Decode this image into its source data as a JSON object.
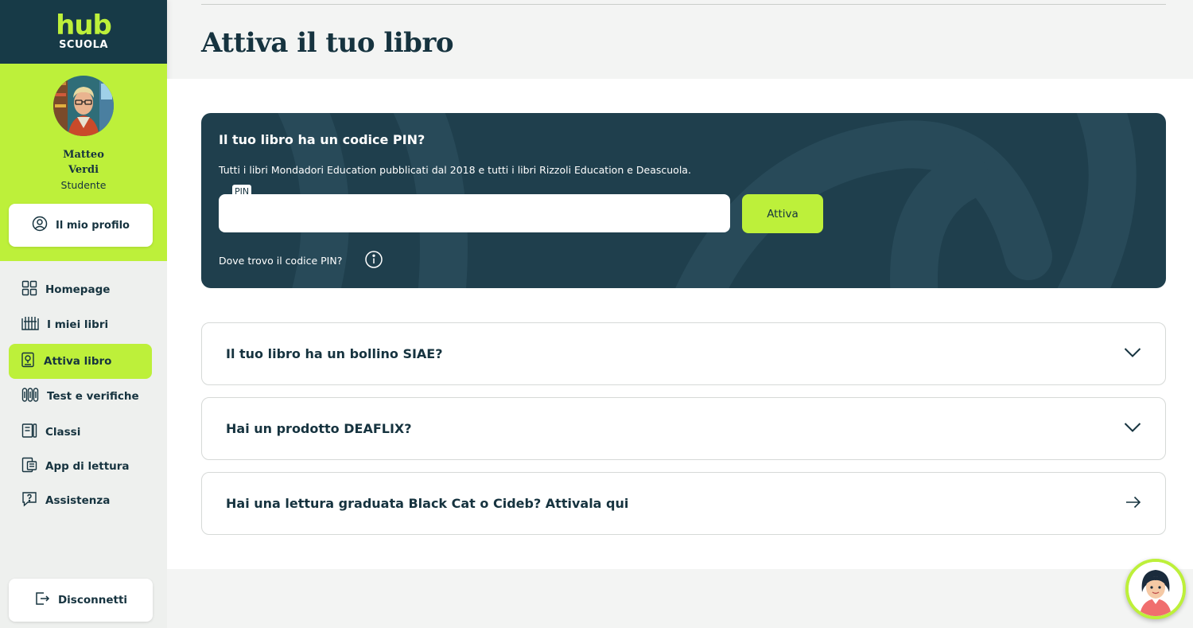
{
  "brand": {
    "line1": "hub",
    "line2": "SCUOLA"
  },
  "user": {
    "first_name": "Matteo",
    "last_name": "Verdi",
    "role": "Studente"
  },
  "profile_button": {
    "label": "Il mio profilo",
    "icon": "user-circle-icon"
  },
  "nav": {
    "items": [
      {
        "label": "Homepage",
        "icon": "grid-icon",
        "active": false
      },
      {
        "label": "I miei libri",
        "icon": "books-icon",
        "active": false
      },
      {
        "label": "Attiva libro",
        "icon": "activate-book-icon",
        "active": true
      },
      {
        "label": "Test e verifiche",
        "icon": "tests-icon",
        "active": false
      },
      {
        "label": "Classi",
        "icon": "classes-icon",
        "active": false
      },
      {
        "label": "App di lettura",
        "icon": "reading-app-icon",
        "active": false
      },
      {
        "label": "Assistenza",
        "icon": "help-chat-icon",
        "active": false
      }
    ]
  },
  "logout_button": {
    "label": "Disconnetti",
    "icon": "logout-icon"
  },
  "page": {
    "title": "Attiva il tuo libro"
  },
  "pin_card": {
    "title": "Il tuo libro ha un codice PIN?",
    "description": "Tutti i libri Mondadori Education pubblicati dal 2018 e tutti i libri Rizzoli Education e Deascuola.",
    "input_label": "PIN",
    "input_value": "",
    "activate_label": "Attiva",
    "help_text": "Dove trovo il codice PIN?",
    "help_icon": "info-icon"
  },
  "accordions": [
    {
      "label": "Il tuo libro ha un bollino SIAE?",
      "icon": "chevron-down-icon"
    },
    {
      "label": "Hai un prodotto DEAFLIX?",
      "icon": "chevron-down-icon"
    },
    {
      "label": "Hai una lettura graduata Black Cat o Cideb? Attivala qui",
      "icon": "arrow-right-icon"
    }
  ],
  "colors": {
    "accent": "#bdf03a",
    "dark": "#173a47",
    "card": "#1f3f4d",
    "text": "#16333f"
  }
}
